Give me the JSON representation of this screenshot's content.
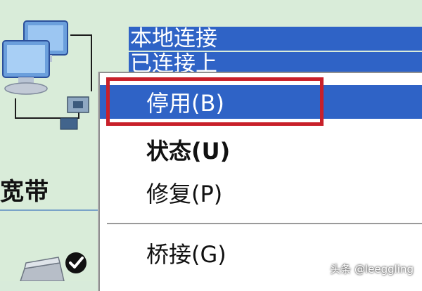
{
  "connection": {
    "name": "本地连接",
    "status": "已连接上"
  },
  "left_panel": {
    "section_title": "宽带"
  },
  "context_menu": {
    "items": [
      {
        "label": "停用(B)",
        "highlighted": true,
        "bold": false
      },
      {
        "label": "状态(U)",
        "highlighted": false,
        "bold": true
      },
      {
        "label": "修复(P)",
        "highlighted": false,
        "bold": false
      },
      {
        "label": "桥接(G)",
        "highlighted": false,
        "bold": false
      }
    ]
  },
  "annotation": {
    "color": "#c8202a"
  },
  "colors": {
    "selection": "#2f63c6",
    "background": "#d9ecd9"
  },
  "icons": [
    "network-connection-icon",
    "broadband-connection-icon",
    "checkmark-icon"
  ],
  "watermark": "头条 @leeggling"
}
